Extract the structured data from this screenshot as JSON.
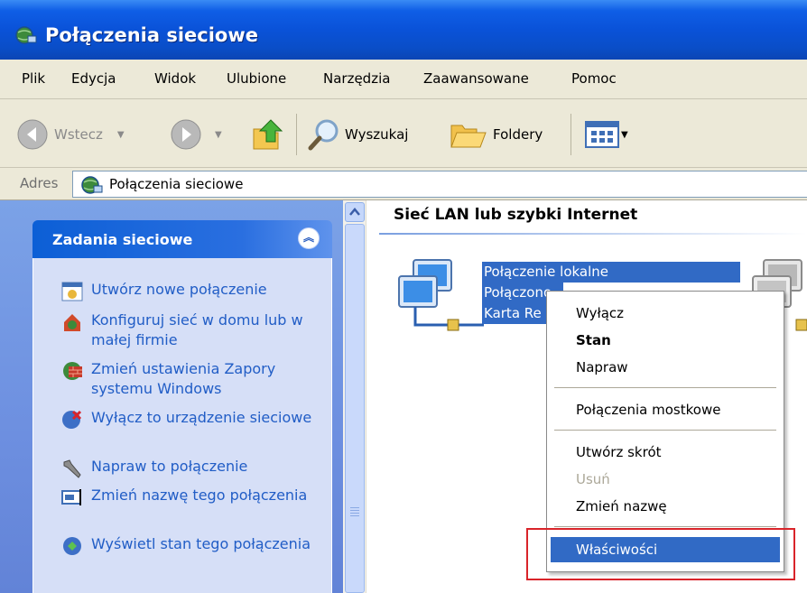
{
  "window": {
    "title": "Połączenia sieciowe"
  },
  "menubar": {
    "items": [
      "Plik",
      "Edycja",
      "Widok",
      "Ulubione",
      "Narzędzia",
      "Zaawansowane",
      "Pomoc"
    ]
  },
  "toolbar": {
    "back_label": "Wstecz",
    "search_label": "Wyszukaj",
    "folders_label": "Foldery"
  },
  "address": {
    "label": "Adres",
    "value": "Połączenia sieciowe"
  },
  "taskpane": {
    "group_title": "Zadania sieciowe",
    "tasks": [
      "Utwórz nowe połączenie",
      "Konfiguruj sieć w domu lub w małej firmie",
      "Zmień ustawienia Zapory systemu Windows",
      "Wyłącz to urządzenie sieciowe",
      "Napraw to połączenie",
      "Zmień nazwę tego połączenia",
      "Wyświetl stan tego połączenia"
    ]
  },
  "content": {
    "group_title": "Sieć LAN lub szybki Internet",
    "connection": {
      "name": "Połączenie lokalne",
      "status": "Połączono",
      "device": "Karta Re"
    }
  },
  "context_menu": {
    "items": [
      {
        "label": "Wyłącz",
        "style": "normal"
      },
      {
        "label": "Stan",
        "style": "bold"
      },
      {
        "label": "Napraw",
        "style": "normal"
      },
      {
        "label": "Połączenia mostkowe",
        "style": "normal"
      },
      {
        "label": "Utwórz skrót",
        "style": "normal"
      },
      {
        "label": "Usuń",
        "style": "disabled"
      },
      {
        "label": "Zmień nazwę",
        "style": "normal"
      },
      {
        "label": "Właściwości",
        "style": "selected"
      }
    ]
  },
  "colors": {
    "titlebar": "#0a52d8",
    "selection": "#316ac5",
    "task_link": "#215dc6",
    "annotation_box": "#d9242a"
  }
}
